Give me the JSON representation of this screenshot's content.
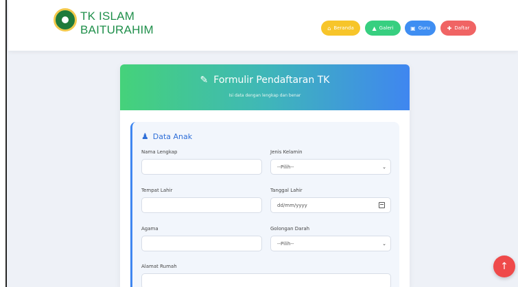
{
  "brand": {
    "line1": "TK ISLAM",
    "line2": "BAITURAHIM"
  },
  "nav": {
    "beranda": "Beranda",
    "galeri": "Galeri",
    "guru": "Guru",
    "daftar": "Daftar"
  },
  "form": {
    "title": "Formulir Pendaftaran TK",
    "subtitle": "Isi data dengan lengkap dan benar",
    "section_title": "Data Anak",
    "fields": {
      "nama_lengkap": {
        "label": "Nama Lengkap",
        "value": ""
      },
      "jenis_kelamin": {
        "label": "Jenis Kelamin",
        "value": "--Pilih--"
      },
      "tempat_lahir": {
        "label": "Tempat Lahir",
        "value": ""
      },
      "tanggal_lahir": {
        "label": "Tanggal Lahir",
        "value": "dd/mm/yyyy"
      },
      "agama": {
        "label": "Agama",
        "value": ""
      },
      "golongan_darah": {
        "label": "Golongan Darah",
        "value": "--Pilih--"
      },
      "alamat_rumah": {
        "label": "Alamat Rumah",
        "value": ""
      }
    }
  },
  "icons": {
    "home": "home-icon",
    "gallery": "graduation-cap-icon",
    "teacher": "id-card-icon",
    "register": "user-plus-icon",
    "pencil": "pencil-icon",
    "child": "child-icon",
    "calendar": "calendar-icon",
    "arrow_up": "arrow-up-icon"
  },
  "colors": {
    "brand_green": "#1f8f4a",
    "beranda": "#f7c52a",
    "galeri": "#37cf80",
    "guru": "#3f8ef2",
    "daftar": "#f06464",
    "accent_blue": "#3f86f0",
    "scroll_top": "#ef4a4a"
  }
}
